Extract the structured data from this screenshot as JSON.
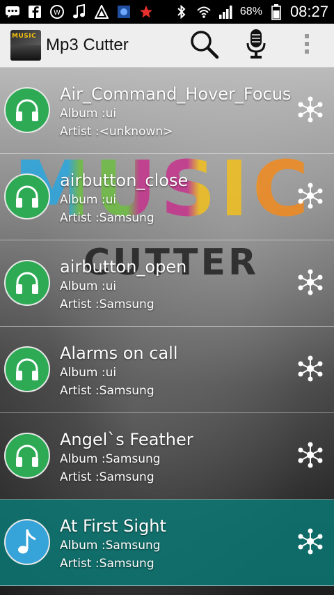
{
  "status_bar": {
    "battery": "68%",
    "time": "08:27",
    "left_icons": [
      "chat-icon",
      "facebook-icon",
      "whatsapp-icon",
      "music-note-icon",
      "vlc-icon",
      "app-icon",
      "star-icon"
    ],
    "right_icons": [
      "bluetooth-icon",
      "wifi-icon",
      "signal-icon",
      "battery-icon"
    ]
  },
  "app_bar": {
    "title": "Mp3 Cutter",
    "logo_text": "MUSIC"
  },
  "background": {
    "big_text": "MUSIC",
    "sub_text": "CUTTER"
  },
  "songs": [
    {
      "title": "Air_Command_Hover_Focus",
      "album": "Album :ui",
      "artist": "Artist :<unknown>",
      "selected": false
    },
    {
      "title": "airbutton_close",
      "album": "Album :ui",
      "artist": "Artist :Samsung",
      "selected": false
    },
    {
      "title": "airbutton_open",
      "album": "Album :ui",
      "artist": "Artist :Samsung",
      "selected": false
    },
    {
      "title": "Alarms on call",
      "album": "Album :ui",
      "artist": "Artist :Samsung",
      "selected": false
    },
    {
      "title": "Angel`s Feather",
      "album": "Album :Samsung",
      "artist": "Artist :Samsung",
      "selected": false
    },
    {
      "title": "At First Sight",
      "album": "Album :Samsung",
      "artist": "Artist :Samsung",
      "selected": true
    }
  ],
  "colors": {
    "avatar_green": "#2eaa55",
    "avatar_blue": "#36a3d9",
    "selected_row": "#0a7873"
  }
}
